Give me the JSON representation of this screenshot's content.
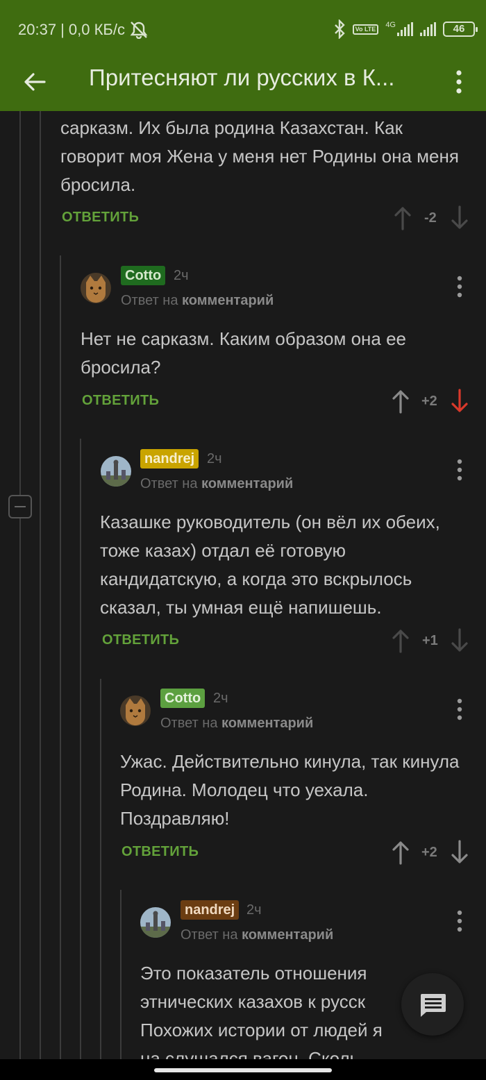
{
  "status_bar": {
    "time": "20:37",
    "speed": "| 0,0 КБ/с",
    "network": "4G",
    "volte": "Vo LTE",
    "battery": "46"
  },
  "app_bar": {
    "title": "Притесняют ли русских в К..."
  },
  "comments": [
    {
      "text": "сарказм. Их была родина Казахстан. Как говорит моя Жена у меня нет Родины она меня бросила.",
      "reply_label": "ОТВЕТИТЬ",
      "score": "-2",
      "vote": "none"
    },
    {
      "username": "Cotto",
      "user_color": "#1f6b1f",
      "time": "2ч",
      "reply_prefix": "Ответ на",
      "reply_target": "комментарий",
      "text": "Нет не сарказм. Каким образом она ее бросила?",
      "reply_label": "ОТВЕТИТЬ",
      "score": "+2",
      "vote": "down"
    },
    {
      "username": "nandrej",
      "user_color": "#c9a400",
      "time": "2ч",
      "reply_prefix": "Ответ на",
      "reply_target": "комментарий",
      "text": "Казашке руководитель (он вёл их обеих, тоже казах) отдал её готовую кандидатскую, а когда это вскрылось сказал, ты умная ещё напишешь.",
      "reply_label": "ОТВЕТИТЬ",
      "score": "+1",
      "vote": "none"
    },
    {
      "username": "Cotto",
      "user_color": "#5ca040",
      "time": "2ч",
      "reply_prefix": "Ответ на",
      "reply_target": "комментарий",
      "text": "Ужас. Действительно кинула, так кинула  Родина. Молодец что уехала. Поздравляю!",
      "reply_label": "ОТВЕТИТЬ",
      "score": "+2",
      "vote": "none"
    },
    {
      "username": "nandrej",
      "user_color": "#6b3d12",
      "time": "2ч",
      "reply_prefix": "Ответ на",
      "reply_target": "комментарий",
      "text": "Это показатель отношения этнических казахов к русск Похожих истории от людей я на слушался вагон. Сколь"
    }
  ],
  "colors": {
    "accent": "#3f6c10",
    "reply": "#63a23a",
    "downvote_active": "#d9392b",
    "background": "#1a1a1a"
  },
  "icons": [
    "back-arrow-icon",
    "kebab-menu-icon",
    "upvote-arrow-icon",
    "downvote-arrow-icon",
    "collapse-thread-icon",
    "comment-icon",
    "bluetooth-icon",
    "mute-icon",
    "signal-icon",
    "battery-icon"
  ]
}
